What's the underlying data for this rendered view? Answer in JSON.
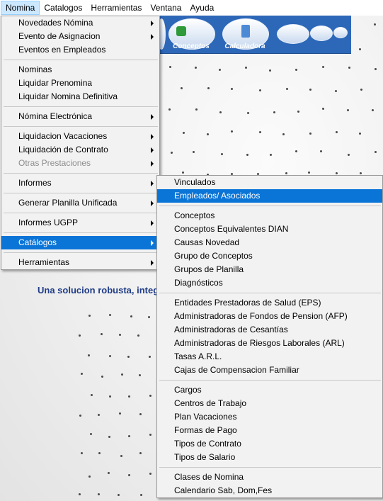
{
  "menubar": [
    "Nomina",
    "Catalogos",
    "Herramientas",
    "Ventana",
    "Ayuda"
  ],
  "toolbar": {
    "btn1": "Conceptos",
    "btn2": "Calculadora"
  },
  "background": {
    "tagline": "Una solucion robusta, integral"
  },
  "nomina_menu": [
    {
      "label": "Novedades Nómina",
      "submenu": true
    },
    {
      "label": "Evento de Asignacion",
      "submenu": true
    },
    {
      "label": "Eventos en Empleados"
    },
    {
      "sep": true
    },
    {
      "label": "Nominas"
    },
    {
      "label": "Liquidar Prenomina"
    },
    {
      "label": "Liquidar Nomina Definitiva"
    },
    {
      "sep": true
    },
    {
      "label": "Nómina Electrónica",
      "submenu": true
    },
    {
      "sep": true
    },
    {
      "label": "Liquidacion Vacaciones",
      "submenu": true
    },
    {
      "label": "Liquidación de Contrato",
      "submenu": true
    },
    {
      "label": "Otras Prestaciones",
      "submenu": true,
      "disabled": true
    },
    {
      "sep": true
    },
    {
      "label": "Informes",
      "submenu": true
    },
    {
      "sep": true
    },
    {
      "label": "Generar Planilla Unificada",
      "submenu": true
    },
    {
      "sep": true
    },
    {
      "label": "Informes UGPP",
      "submenu": true
    },
    {
      "sep": true
    },
    {
      "label": "Catálogos",
      "submenu": true,
      "highlighted": true
    },
    {
      "sep": true
    },
    {
      "label": "Herramientas",
      "submenu": true
    }
  ],
  "catalogos_menu": [
    {
      "label": "Vinculados"
    },
    {
      "label": "Empleados/ Asociados",
      "highlighted": true
    },
    {
      "sep": true
    },
    {
      "label": "Conceptos"
    },
    {
      "label": "Conceptos Equivalentes DIAN"
    },
    {
      "label": "Causas Novedad"
    },
    {
      "label": "Grupo de Conceptos"
    },
    {
      "label": "Grupos de Planilla"
    },
    {
      "label": "Diagnósticos"
    },
    {
      "sep": true
    },
    {
      "label": "Entidades Prestadoras de Salud (EPS)"
    },
    {
      "label": "Administradoras de Fondos de Pension (AFP)"
    },
    {
      "label": "Administradoras de Cesantías"
    },
    {
      "label": "Administradoras de Riesgos Laborales (ARL)"
    },
    {
      "label": "Tasas A.R.L."
    },
    {
      "label": "Cajas de Compensacion Familiar"
    },
    {
      "sep": true
    },
    {
      "label": "Cargos"
    },
    {
      "label": "Centros de Trabajo"
    },
    {
      "label": "Plan Vacaciones"
    },
    {
      "label": "Formas de Pago"
    },
    {
      "label": "Tipos de Contrato"
    },
    {
      "label": "Tipos de Salario"
    },
    {
      "sep": true
    },
    {
      "label": "Clases de Nomina"
    },
    {
      "label": "Calendario Sab, Dom,Fes"
    }
  ],
  "colors": {
    "highlight": "#0a74d7",
    "toolbar": "#2d67b8",
    "menubar_open": "#cce8ff"
  }
}
